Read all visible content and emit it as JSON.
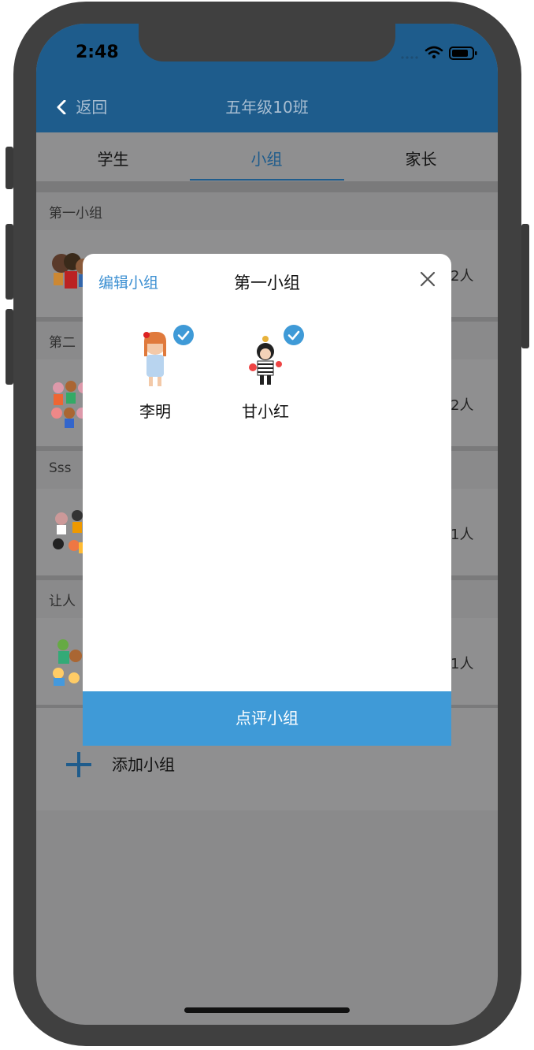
{
  "status_bar": {
    "time": "2:48"
  },
  "nav": {
    "back_label": "返回",
    "title": "五年级10班"
  },
  "tabs": [
    {
      "label": "学生",
      "active": false
    },
    {
      "label": "小组",
      "active": true
    },
    {
      "label": "家长",
      "active": false
    }
  ],
  "groups": [
    {
      "name": "第一小组",
      "count": "2人"
    },
    {
      "name": "第二",
      "count": "2人"
    },
    {
      "name": "Sss",
      "count": "1人"
    },
    {
      "name": "让人",
      "count": "1人"
    }
  ],
  "add_group": {
    "label": "添加小组"
  },
  "modal": {
    "edit_label": "编辑小组",
    "title": "第一小组",
    "members": [
      {
        "name": "李明",
        "selected": true
      },
      {
        "name": "甘小红",
        "selected": true
      }
    ],
    "action_label": "点评小组"
  },
  "colors": {
    "accent": "#3f9ad7",
    "header": "#1e5c8c",
    "overlay": "#8a8a8b"
  }
}
